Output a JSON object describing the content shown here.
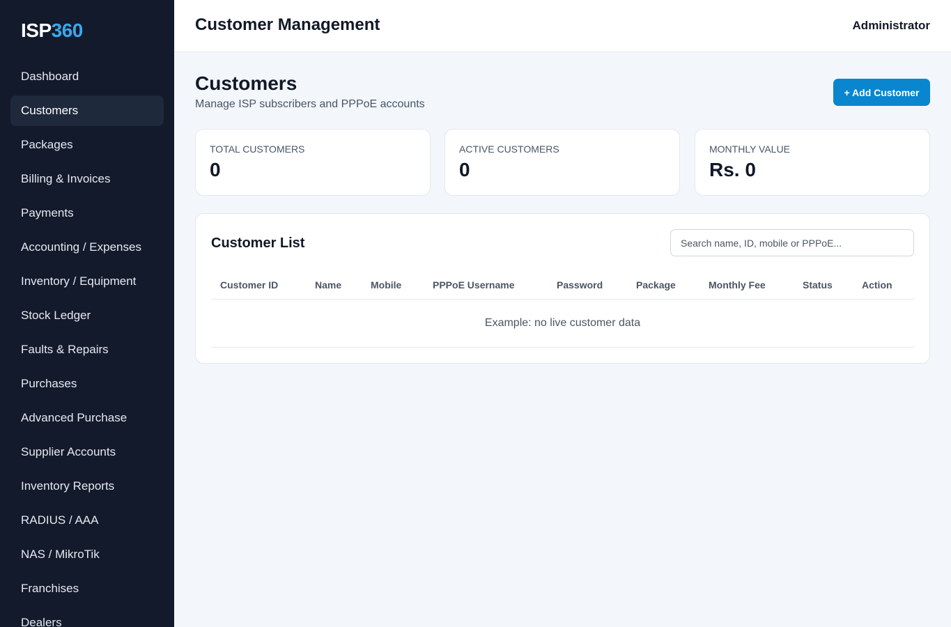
{
  "app": {
    "logo_main": "ISP",
    "logo_accent": "360"
  },
  "sidebar": {
    "items": [
      {
        "label": "Dashboard"
      },
      {
        "label": "Customers",
        "active": true
      },
      {
        "label": "Packages"
      },
      {
        "label": "Billing & Invoices"
      },
      {
        "label": "Payments"
      },
      {
        "label": "Accounting / Expenses"
      },
      {
        "label": "Inventory / Equipment"
      },
      {
        "label": "Stock Ledger"
      },
      {
        "label": "Faults & Repairs"
      },
      {
        "label": "Purchases"
      },
      {
        "label": "Advanced Purchase"
      },
      {
        "label": "Supplier Accounts"
      },
      {
        "label": "Inventory Reports"
      },
      {
        "label": "RADIUS / AAA"
      },
      {
        "label": "NAS / MikroTik"
      },
      {
        "label": "Franchises"
      },
      {
        "label": "Dealers"
      }
    ]
  },
  "header": {
    "title": "Customer Management",
    "user": "Administrator"
  },
  "page": {
    "title": "Customers",
    "subtitle": "Manage ISP subscribers and PPPoE accounts",
    "add_button": "+ Add Customer"
  },
  "stats": {
    "total": {
      "label": "TOTAL CUSTOMERS",
      "value": "0"
    },
    "active": {
      "label": "ACTIVE CUSTOMERS",
      "value": "0"
    },
    "monthly": {
      "label": "MONTHLY VALUE",
      "value": "Rs. 0"
    }
  },
  "customer_list": {
    "title": "Customer List",
    "search_placeholder": "Search name, ID, mobile or PPPoE...",
    "columns": [
      "Customer ID",
      "Name",
      "Mobile",
      "PPPoE Username",
      "Password",
      "Package",
      "Monthly Fee",
      "Status",
      "Action"
    ],
    "empty_message": "Example: no live customer data"
  },
  "colors": {
    "sidebar_bg": "#121a2b",
    "sidebar_active": "#1e293b",
    "logo_accent": "#38a9ec",
    "primary_button": "#0a86cf",
    "page_bg": "#f3f6fa"
  }
}
